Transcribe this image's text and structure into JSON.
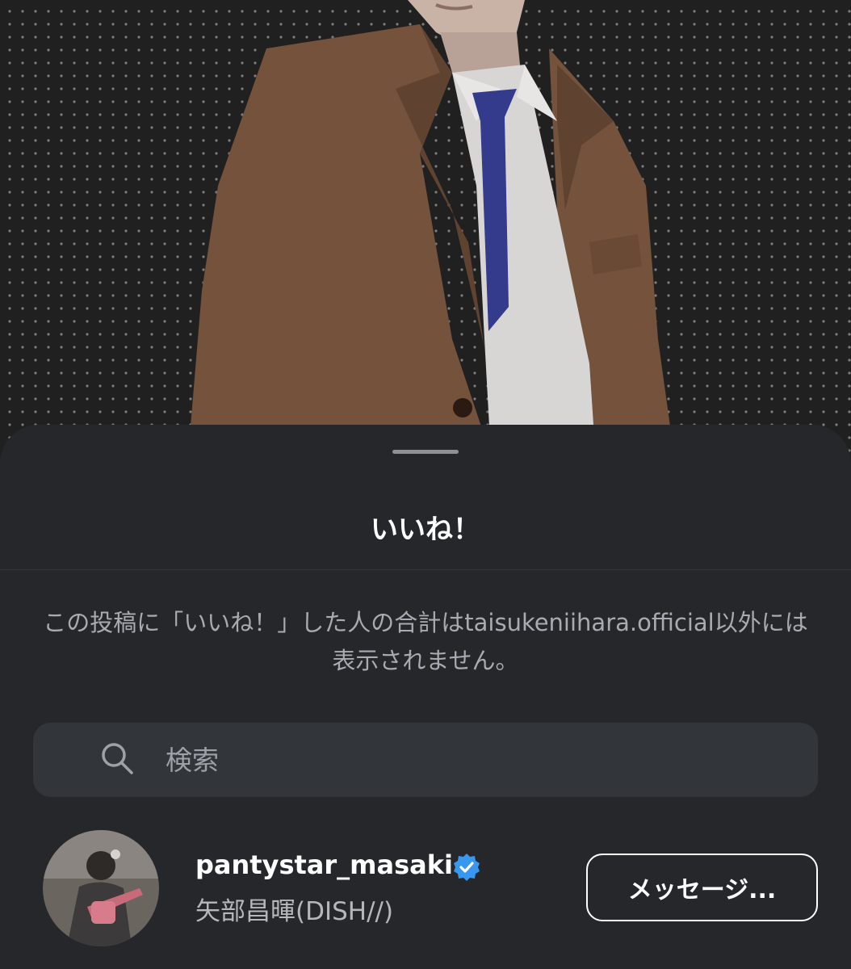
{
  "photo": {
    "description_icon": "person-photo"
  },
  "sheet": {
    "title": "いいね！",
    "notice": "この投稿に「いいね！」した人の合計はtaisukeniihara.official以外には表示されません。"
  },
  "search": {
    "placeholder": "検索",
    "value": "",
    "icon": "search-icon"
  },
  "users": [
    {
      "username": "pantystar_masaki",
      "full_name": "矢部昌暉(DISH//)",
      "verified": true,
      "button_label": "メッセージ..."
    }
  ],
  "colors": {
    "sheet_bg": "#25272b",
    "search_bg": "#32353a",
    "verified_blue": "#3897f0",
    "text_primary": "#ffffff",
    "text_secondary": "#a8abb1"
  }
}
